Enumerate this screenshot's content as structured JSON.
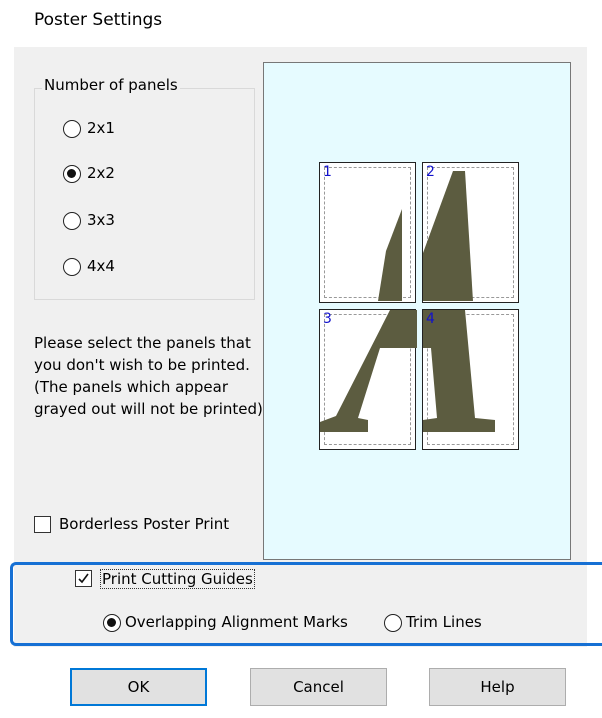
{
  "dialog": {
    "title": "Poster Settings"
  },
  "panels_group": {
    "legend": "Number of panels",
    "options": [
      {
        "label": "2x1",
        "selected": false
      },
      {
        "label": "2x2",
        "selected": true
      },
      {
        "label": "3x3",
        "selected": false
      },
      {
        "label": "4x4",
        "selected": false
      }
    ]
  },
  "instruction_text": "Please select the panels that you don't wish to be printed. (The panels which appear grayed out will not be printed)",
  "preview": {
    "panels": [
      {
        "number": "1"
      },
      {
        "number": "2"
      },
      {
        "number": "3"
      },
      {
        "number": "4"
      }
    ],
    "glyph_color": "#5c5c40",
    "background_color": "#e6fbff"
  },
  "borderless_poster_print": {
    "label": "Borderless Poster Print",
    "checked": false
  },
  "print_cutting_guides": {
    "label": "Print Cutting Guides",
    "checked": true
  },
  "guide_type": {
    "options": [
      {
        "label": "Overlapping Alignment Marks",
        "selected": true
      },
      {
        "label": "Trim Lines",
        "selected": false
      }
    ]
  },
  "buttons": {
    "ok": "OK",
    "cancel": "Cancel",
    "help": "Help"
  },
  "colors": {
    "highlight_border": "#1670d4",
    "panel_number": "#1212cc",
    "default_button_border": "#0078d7"
  }
}
